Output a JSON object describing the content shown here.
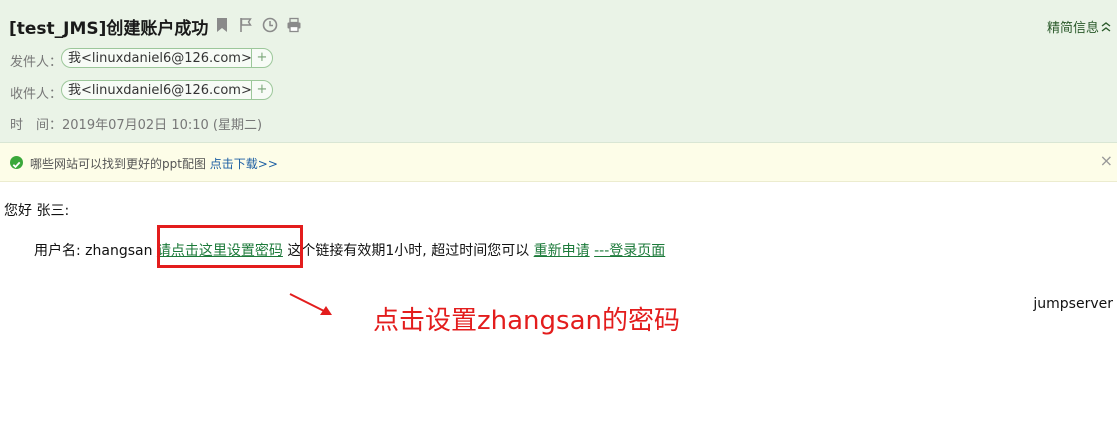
{
  "email": {
    "subject": "[test_JMS]创建账户成功",
    "simple_info": "精简信息",
    "from_label": "发件人：",
    "from_value": "我<linuxdaniel6@126.com>",
    "to_label": "收件人：",
    "to_value": "我<linuxdaniel6@126.com>",
    "time_label": "时　间：",
    "time_value": "2019年07月02日 10:10 (星期二)",
    "add_symbol": "+"
  },
  "notice": {
    "text": "哪些网站可以找到更好的ppt配图",
    "link": "点击下载>>",
    "close": "×"
  },
  "content": {
    "greeting": "您好 张三:",
    "username_prefix": "用户名: zhangsan",
    "set_password_link": "请点击这里设置密码",
    "validity_text": "这个链接有效期1小时, 超过时间您可以",
    "reapply_link": "重新申请",
    "login_link": "---登录页面",
    "signature": "jumpserver"
  },
  "annotation": {
    "text": "点击设置zhangsan的密码",
    "color": "#e31d1d"
  },
  "icons": [
    "bookmark-icon",
    "flag-icon",
    "clock-icon",
    "print-icon",
    "check-circle-icon",
    "chevron-up-icon",
    "close-icon"
  ]
}
